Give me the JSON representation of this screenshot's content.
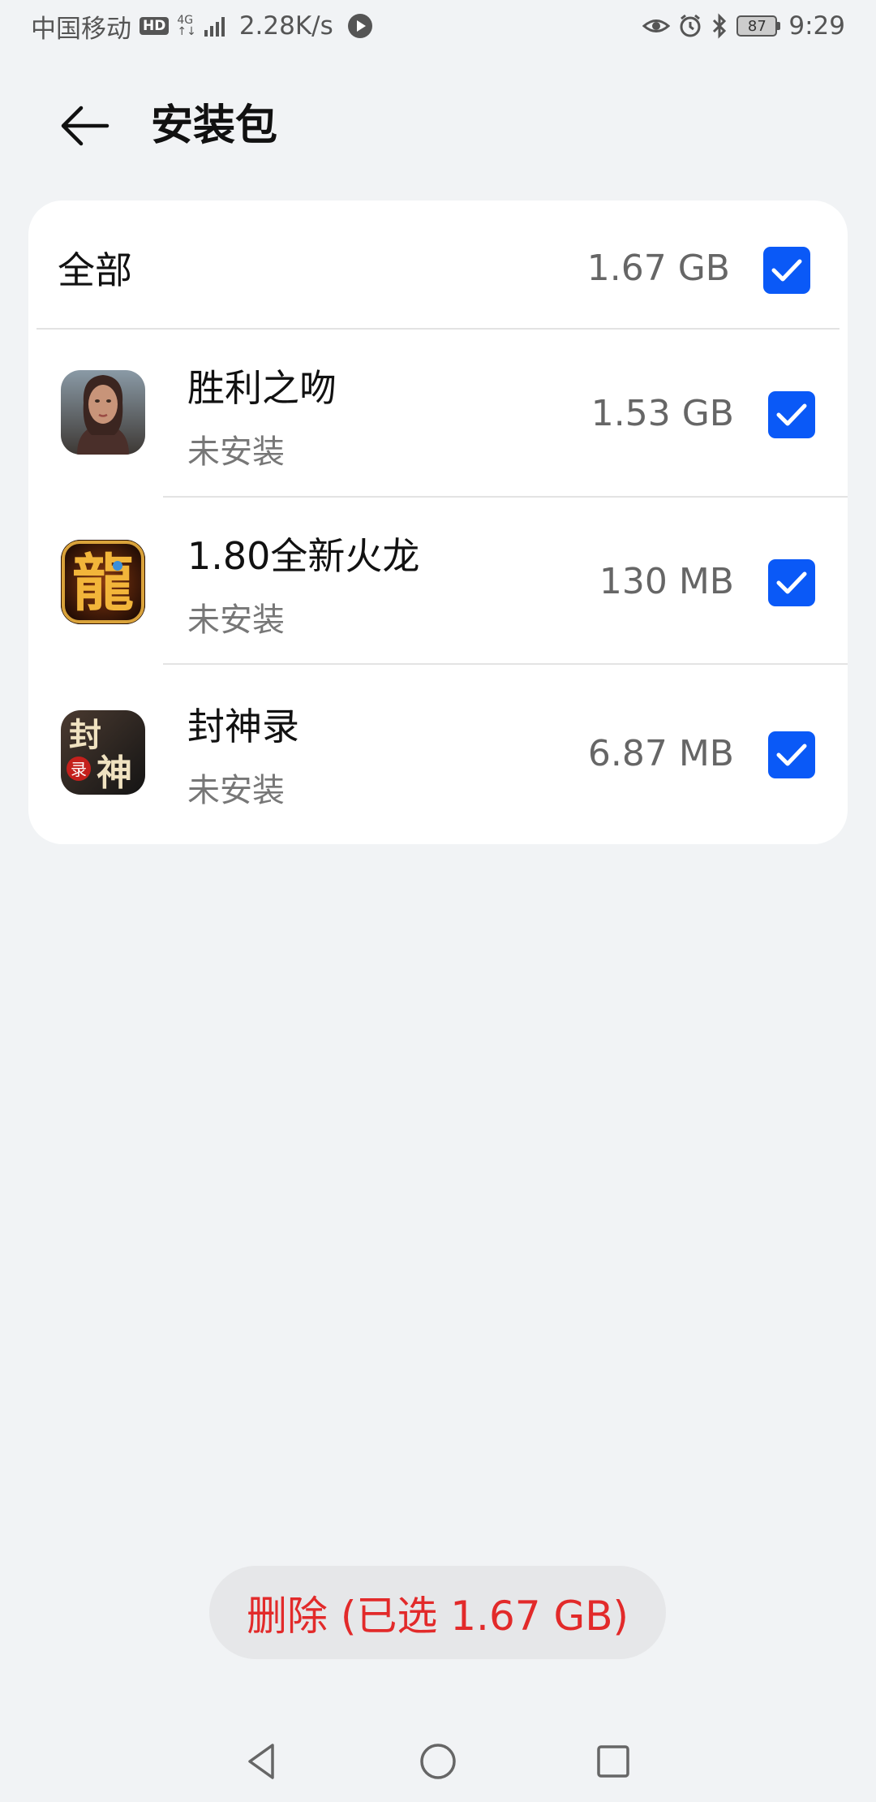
{
  "status_bar": {
    "carrier": "中国移动",
    "hd_badge": "HD",
    "network_type": "4G",
    "network_sub": "↑↓",
    "speed": "2.28K/s",
    "battery": "87",
    "time": "9:29",
    "icons": [
      "eye-comfort-icon",
      "alarm-icon",
      "bluetooth-icon",
      "battery-icon"
    ]
  },
  "header": {
    "back_icon": "back-arrow-icon",
    "title": "安装包"
  },
  "select_all": {
    "label": "全部",
    "size": "1.67 GB",
    "checked": true
  },
  "items": [
    {
      "name": "胜利之吻",
      "status": "未安装",
      "size": "1.53 GB",
      "checked": true,
      "icon": "portrait-game-icon"
    },
    {
      "name": "1.80全新火龙",
      "status": "未安装",
      "size": "130 MB",
      "checked": true,
      "icon": "dragon-glyph-icon"
    },
    {
      "name": "封神录",
      "status": "未安装",
      "size": "6.87 MB",
      "checked": true,
      "icon": "fengshen-glyph-icon"
    }
  ],
  "icon_glyphs": {
    "dragon": "龍",
    "fengshen_top": "封",
    "fengshen_bottom": "神",
    "fengshen_badge": "录"
  },
  "delete_button": {
    "label": "删除 (已选 1.67 GB)"
  },
  "colors": {
    "accent": "#0a59f7",
    "danger": "#e22a2a",
    "background": "#f1f3f5"
  },
  "nav": [
    "back-triangle-icon",
    "home-circle-icon",
    "recents-square-icon"
  ]
}
